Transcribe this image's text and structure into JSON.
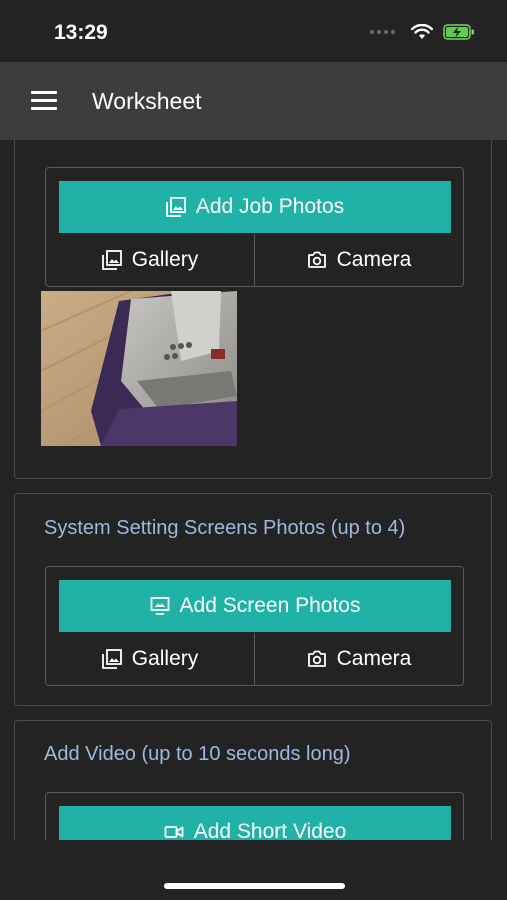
{
  "status": {
    "time": "13:29"
  },
  "header": {
    "title": "Worksheet"
  },
  "job_photos": {
    "add_label": "Add Job Photos",
    "gallery_label": "Gallery",
    "camera_label": "Camera"
  },
  "screen_photos": {
    "title": "System Setting Screens Photos (up to 4)",
    "add_label": "Add Screen Photos",
    "gallery_label": "Gallery",
    "camera_label": "Camera"
  },
  "video": {
    "title": "Add Video (up to 10 seconds long)",
    "add_label": "Add Short Video"
  },
  "colors": {
    "accent": "#20b2a6",
    "section_title": "#9fb8de",
    "background": "#232323",
    "header": "#3d3d3d"
  }
}
